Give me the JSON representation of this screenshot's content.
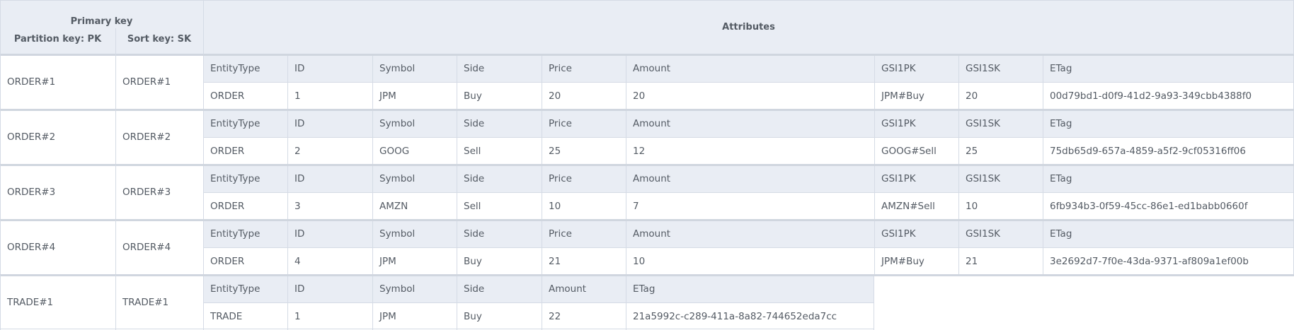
{
  "header": {
    "primary_key": "Primary key",
    "partition_key": "Partition key: PK",
    "sort_key": "Sort key: SK",
    "attributes": "Attributes"
  },
  "items": [
    {
      "pk": "ORDER#1",
      "sk": "ORDER#1",
      "attrs": [
        {
          "label": "EntityType",
          "value": "ORDER"
        },
        {
          "label": "ID",
          "value": "1"
        },
        {
          "label": "Symbol",
          "value": "JPM"
        },
        {
          "label": "Side",
          "value": "Buy"
        },
        {
          "label": "Price",
          "value": "20"
        },
        {
          "label": "Amount",
          "value": "20"
        },
        {
          "label": "GSI1PK",
          "value": "JPM#Buy"
        },
        {
          "label": "GSI1SK",
          "value": "20"
        },
        {
          "label": "ETag",
          "value": "00d79bd1-d0f9-41d2-9a93-349cbb4388f0"
        }
      ]
    },
    {
      "pk": "ORDER#2",
      "sk": "ORDER#2",
      "attrs": [
        {
          "label": "EntityType",
          "value": "ORDER"
        },
        {
          "label": "ID",
          "value": "2"
        },
        {
          "label": "Symbol",
          "value": "GOOG"
        },
        {
          "label": "Side",
          "value": "Sell"
        },
        {
          "label": "Price",
          "value": "25"
        },
        {
          "label": "Amount",
          "value": "12"
        },
        {
          "label": "GSI1PK",
          "value": "GOOG#Sell"
        },
        {
          "label": "GSI1SK",
          "value": "25"
        },
        {
          "label": "ETag",
          "value": "75db65d9-657a-4859-a5f2-9cf05316ff06"
        }
      ]
    },
    {
      "pk": "ORDER#3",
      "sk": "ORDER#3",
      "attrs": [
        {
          "label": "EntityType",
          "value": "ORDER"
        },
        {
          "label": "ID",
          "value": "3"
        },
        {
          "label": "Symbol",
          "value": "AMZN"
        },
        {
          "label": "Side",
          "value": "Sell"
        },
        {
          "label": "Price",
          "value": "10"
        },
        {
          "label": "Amount",
          "value": "7"
        },
        {
          "label": "GSI1PK",
          "value": "AMZN#Sell"
        },
        {
          "label": "GSI1SK",
          "value": "10"
        },
        {
          "label": "ETag",
          "value": "6fb934b3-0f59-45cc-86e1-ed1babb0660f"
        }
      ]
    },
    {
      "pk": "ORDER#4",
      "sk": "ORDER#4",
      "attrs": [
        {
          "label": "EntityType",
          "value": "ORDER"
        },
        {
          "label": "ID",
          "value": "4"
        },
        {
          "label": "Symbol",
          "value": "JPM"
        },
        {
          "label": "Side",
          "value": "Buy"
        },
        {
          "label": "Price",
          "value": "21"
        },
        {
          "label": "Amount",
          "value": "10"
        },
        {
          "label": "GSI1PK",
          "value": "JPM#Buy"
        },
        {
          "label": "GSI1SK",
          "value": "21"
        },
        {
          "label": "ETag",
          "value": "3e2692d7-7f0e-43da-9371-af809a1ef00b"
        }
      ]
    },
    {
      "pk": "TRADE#1",
      "sk": "TRADE#1",
      "attrs": [
        {
          "label": "EntityType",
          "value": "TRADE"
        },
        {
          "label": "ID",
          "value": "1"
        },
        {
          "label": "Symbol",
          "value": "JPM"
        },
        {
          "label": "Side",
          "value": "Buy"
        },
        {
          "label": "Amount",
          "value": "22"
        },
        {
          "label": "ETag",
          "value": "21a5992c-c289-411a-8a82-744652eda7cc"
        }
      ]
    }
  ]
}
